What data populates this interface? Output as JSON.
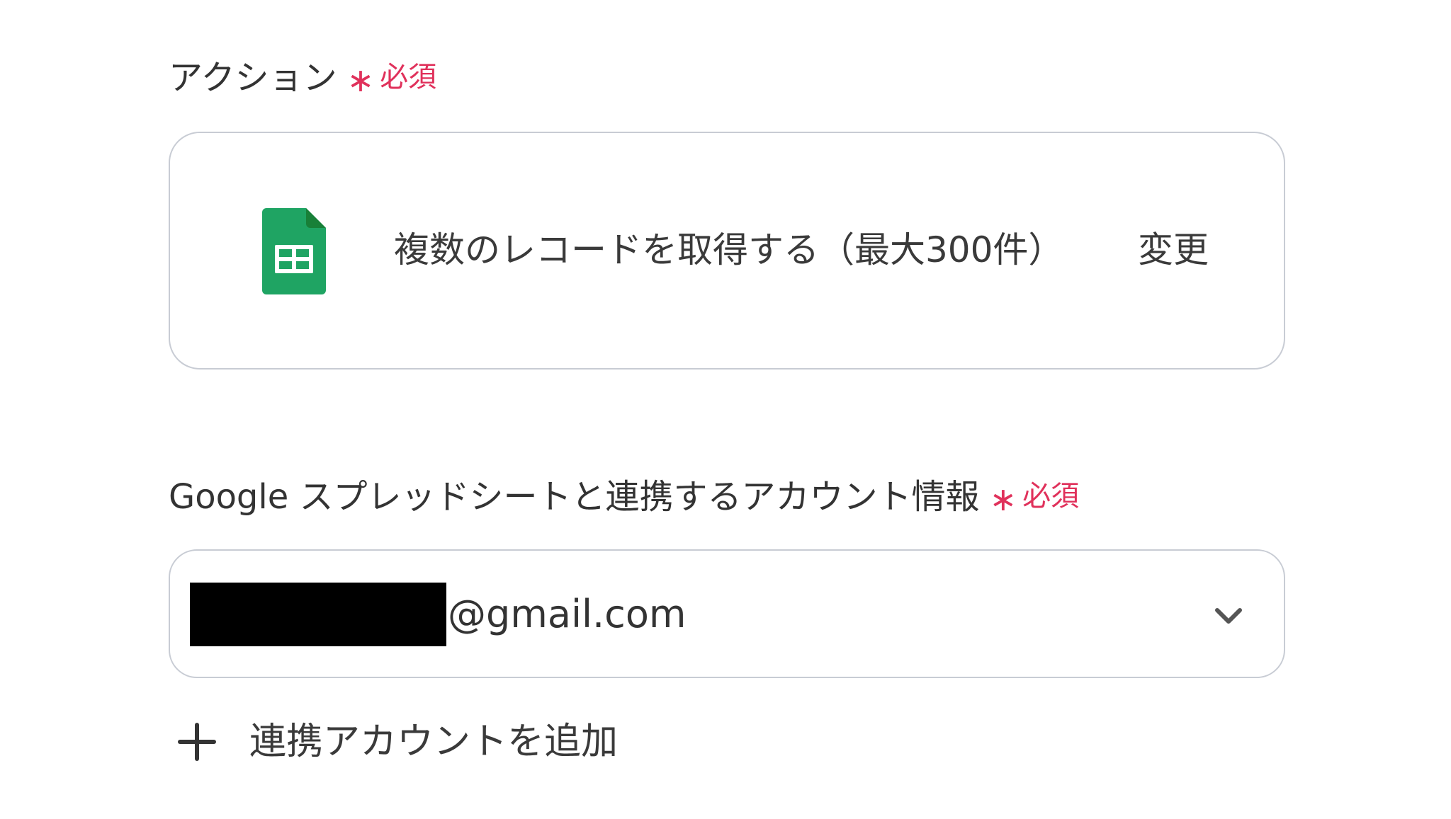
{
  "action_field": {
    "label": "アクション",
    "required_mark": "∗",
    "required_text": "必須",
    "app_icon": "google-sheets-icon",
    "action_name": "複数のレコードを取得する（最大300件）",
    "change_label": "変更"
  },
  "account_field": {
    "label": "Google スプレッドシートと連携するアカウント情報",
    "required_mark": "∗",
    "required_text": "必須",
    "selected_value_suffix": "@gmail.com",
    "dropdown_icon": "chevron-down-icon"
  },
  "add_account": {
    "icon": "plus-icon",
    "label": "連携アカウントを追加"
  },
  "colors": {
    "required": "#e0315b",
    "sheets_green": "#1fa463",
    "border": "#c8ccd4",
    "text": "#333333"
  }
}
